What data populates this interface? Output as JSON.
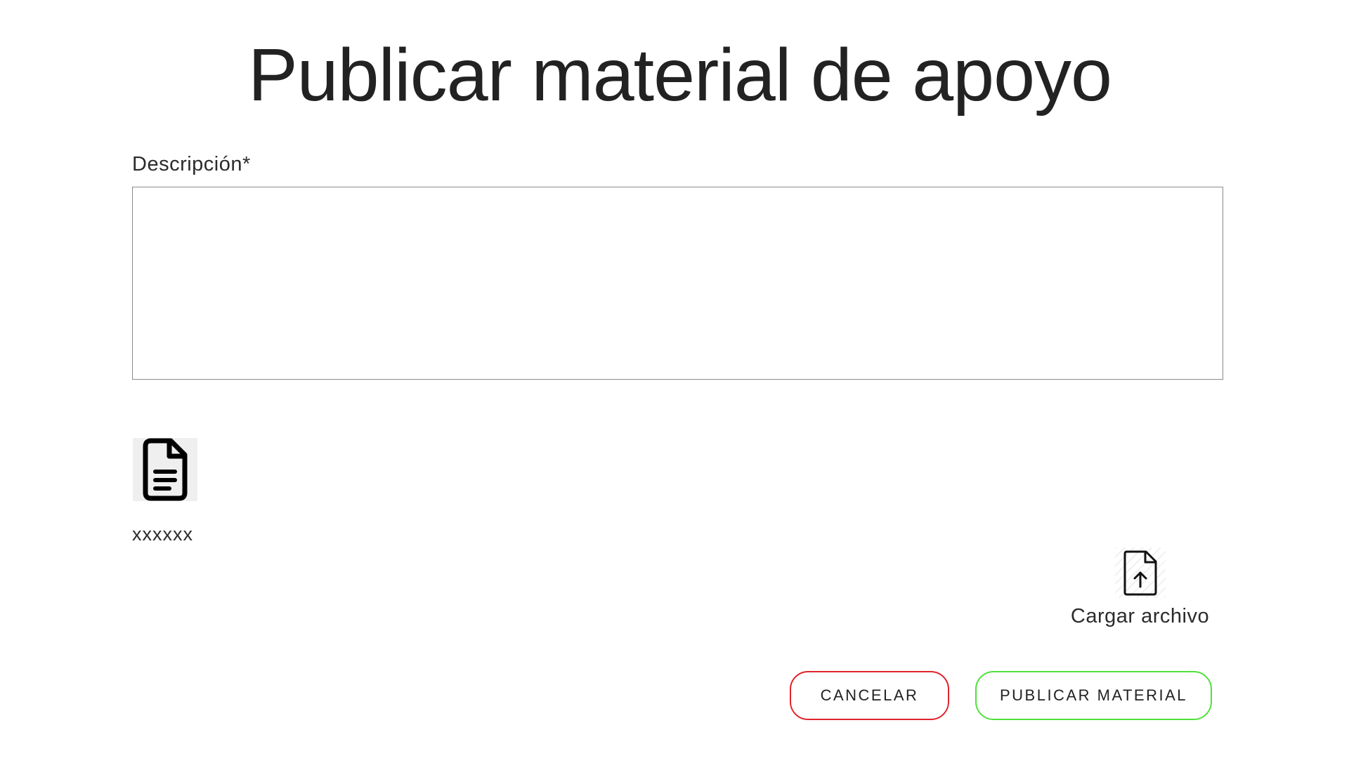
{
  "header": {
    "title": "Publicar material de apoyo"
  },
  "form": {
    "description_label": "Descripción*",
    "description_value": ""
  },
  "attachment": {
    "icon": "document-icon",
    "file_name": "xxxxxx"
  },
  "upload": {
    "icon": "file-upload-icon",
    "label": "Cargar archivo"
  },
  "actions": {
    "cancel_label": "CANCELAR",
    "publish_label": "PUBLICAR MATERIAL"
  },
  "colors": {
    "cancel_border": "#e0232b",
    "publish_border": "#4fe13a"
  }
}
